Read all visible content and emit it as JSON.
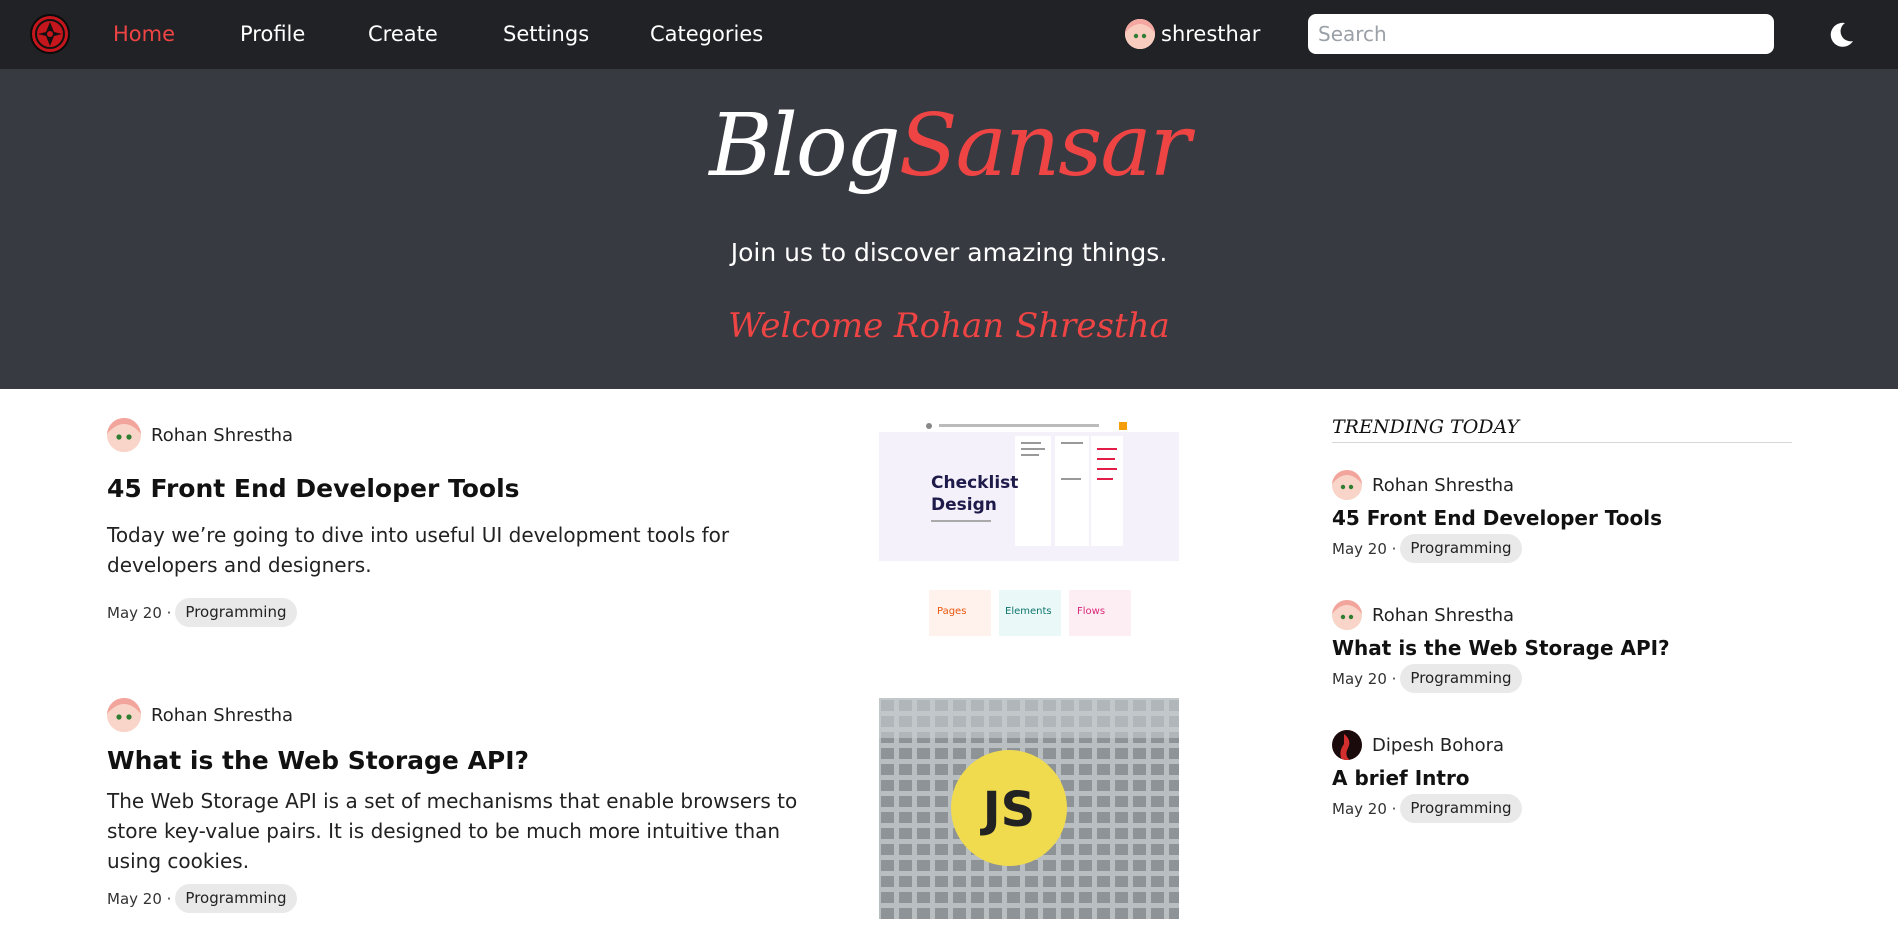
{
  "nav": {
    "links": [
      "Home",
      "Profile",
      "Create",
      "Settings",
      "Categories"
    ],
    "username": "shresthar",
    "search_placeholder": "Search",
    "accent": "#ef4444",
    "icons": [
      "logo-icon",
      "avatar",
      "moon-icon"
    ]
  },
  "hero": {
    "brand_part1": "Blog",
    "brand_part2": "Sansar",
    "tagline": "Join us to discover amazing things.",
    "welcome": "Welcome Rohan Shrestha"
  },
  "posts": [
    {
      "author": "Rohan Shrestha",
      "title": "45 Front End Developer Tools",
      "description": "Today we’re going to dive into useful UI development tools for developers and designers.",
      "date": "May 20 ·",
      "tag": "Programming",
      "thumb_text": {
        "heading": "Checklist Design",
        "chips": [
          "Pages",
          "Elements",
          "Flows"
        ]
      }
    },
    {
      "author": "Rohan Shrestha",
      "title": "What is the Web Storage API?",
      "description": "The Web Storage API is a set of mechanisms that enable browsers to store key-value pairs. It is designed to be much more intuitive than using cookies.",
      "date": "May 20 ·",
      "tag": "Programming",
      "thumb_text": {
        "badge": "JS"
      }
    }
  ],
  "trending": {
    "heading": "TRENDING TODAY",
    "items": [
      {
        "author": "Rohan Shrestha",
        "title": "45 Front End Developer Tools",
        "date": "May 20 ·",
        "tag": "Programming"
      },
      {
        "author": "Rohan Shrestha",
        "title": "What is the Web Storage API?",
        "date": "May 20 ·",
        "tag": "Programming"
      },
      {
        "author": "Dipesh Bohora",
        "title": "A brief Intro",
        "date": "May 20 ·",
        "tag": "Programming"
      }
    ]
  }
}
